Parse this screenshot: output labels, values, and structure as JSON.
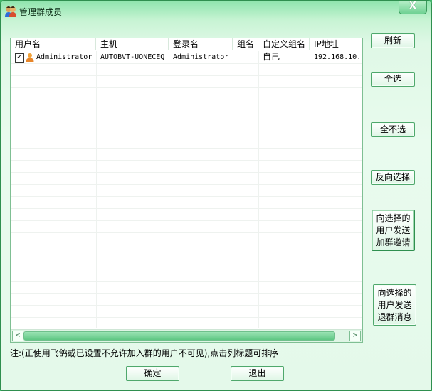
{
  "window": {
    "title": "管理群成员",
    "close_label": "X"
  },
  "table": {
    "columns": [
      "用户名",
      "主机",
      "登录名",
      "组名",
      "自定义组名",
      "IP地址"
    ],
    "rows": [
      {
        "checked": true,
        "username": "Administrator",
        "host": "AUTOBVT-UONECEQ",
        "login": "Administrator",
        "group": "",
        "custom_group": "自己",
        "ip": "192.168.10."
      }
    ]
  },
  "buttons": {
    "refresh": "刷新",
    "select_all": "全选",
    "select_none": "全不选",
    "invert": "反向选择",
    "invite": [
      "向选择的",
      "用户发送",
      "加群邀请"
    ],
    "quit_msg": [
      "向选择的",
      "用户发送",
      "退群消息"
    ],
    "ok": "确定",
    "exit": "退出"
  },
  "note": "注:(正使用飞鸽或已设置不允许加入群的用户不可见),点击列标题可排序",
  "colors": {
    "accent": "#3fb86a",
    "title_text": "#0a2a14"
  }
}
